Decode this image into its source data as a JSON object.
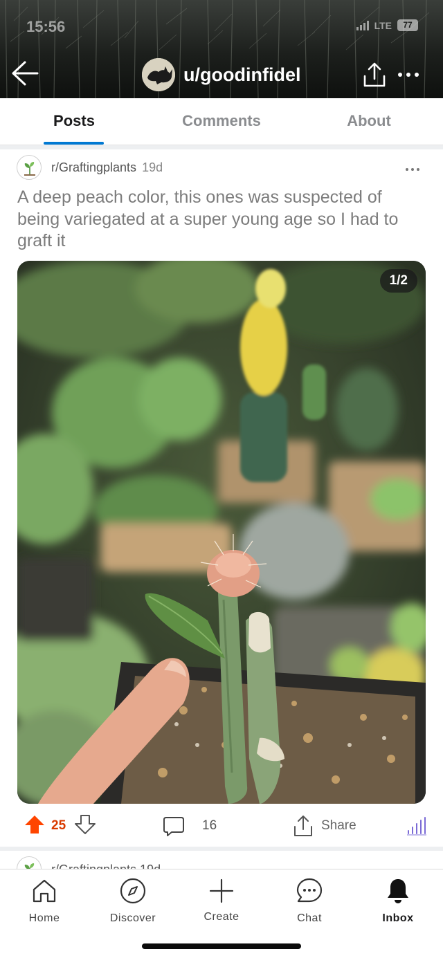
{
  "status_bar": {
    "time": "15:56",
    "network": "LTE",
    "battery": "77"
  },
  "header": {
    "username": "u/goodinfidel"
  },
  "tabs": [
    {
      "label": "Posts",
      "active": true
    },
    {
      "label": "Comments",
      "active": false
    },
    {
      "label": "About",
      "active": false
    }
  ],
  "post": {
    "subreddit": "r/Graftingplants",
    "age": "19d",
    "title": "A deep peach color, this ones was suspected of being variegated at a super young age so I had to graft it",
    "media_counter": "1/2",
    "upvotes": "25",
    "comments": "16",
    "share_label": "Share"
  },
  "next_post": {
    "subreddit_line": "r/Graftingplants 19d"
  },
  "bottom_nav": [
    {
      "label": "Home",
      "icon": "home-icon"
    },
    {
      "label": "Discover",
      "icon": "compass-icon"
    },
    {
      "label": "Create",
      "icon": "plus-icon"
    },
    {
      "label": "Chat",
      "icon": "chat-icon"
    },
    {
      "label": "Inbox",
      "icon": "bell-icon",
      "active": true
    }
  ],
  "colors": {
    "upvote": "#ff4500",
    "accent": "#0079d3",
    "chart_icon": "#7b6bd6"
  }
}
